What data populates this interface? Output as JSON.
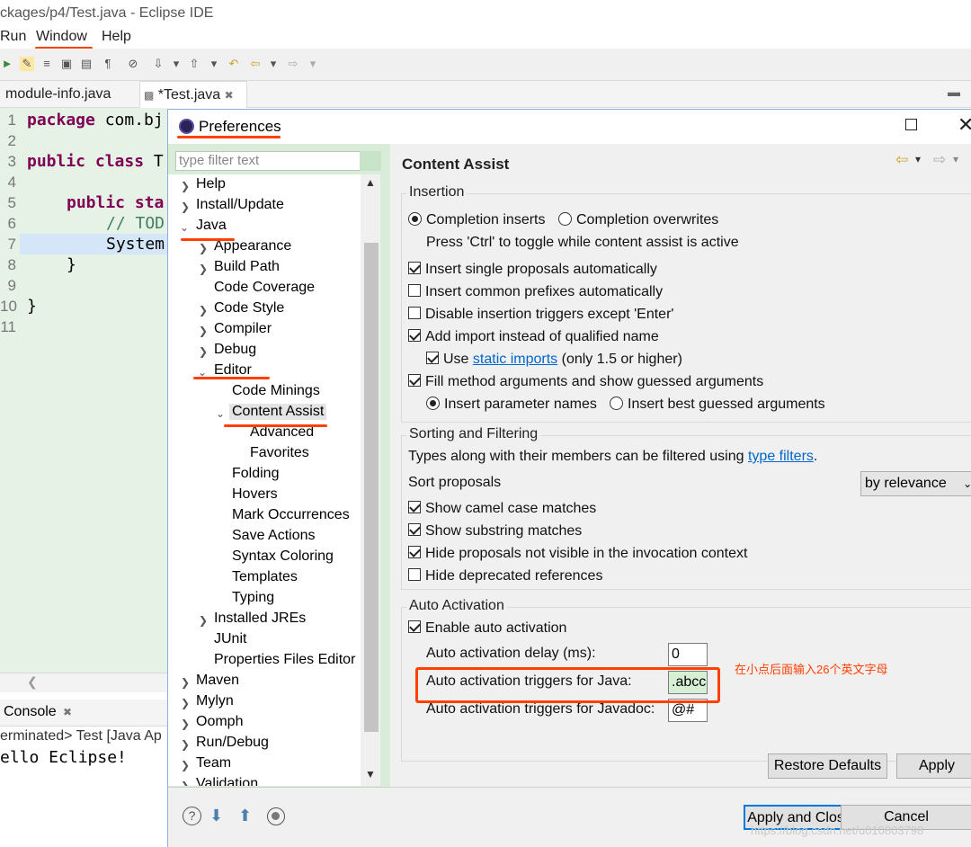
{
  "eclipse": {
    "title": "ckages/p4/Test.java - Eclipse IDE",
    "menu": [
      "Run",
      "Window",
      "Help"
    ],
    "tabs": [
      {
        "label": "module-info.java"
      },
      {
        "label": "*Test.java"
      }
    ],
    "line_numbers": [
      "1",
      "2",
      "3",
      "4",
      "5",
      "6",
      "7",
      "8",
      "9",
      "10",
      "11"
    ],
    "code": {
      "l1_kw": "package",
      "l1_rest": " com.bj",
      "l3_kw": "public class",
      "l3_rest": " T",
      "l5_kw": "public sta",
      "l6": "// TOD",
      "l7": "System",
      "l8": "}",
      "l10": "}"
    },
    "console_tab": "Console",
    "console_status": "erminated> Test [Java Ap",
    "console_output": "ello Eclipse!"
  },
  "dialog": {
    "title": "Preferences",
    "filter_placeholder": "type filter text",
    "tree": {
      "help": "Help",
      "install": "Install/Update",
      "java": "Java",
      "appearance": "Appearance",
      "build_path": "Build Path",
      "code_coverage": "Code Coverage",
      "code_style": "Code Style",
      "compiler": "Compiler",
      "debug": "Debug",
      "editor": "Editor",
      "code_minings": "Code Minings",
      "content_assist": "Content Assist",
      "advanced": "Advanced",
      "favorites": "Favorites",
      "folding": "Folding",
      "hovers": "Hovers",
      "mark_occurrences": "Mark Occurrences",
      "save_actions": "Save Actions",
      "syntax_coloring": "Syntax Coloring",
      "templates": "Templates",
      "typing": "Typing",
      "installed_jres": "Installed JREs",
      "junit": "JUnit",
      "props_editor": "Properties Files Editor",
      "maven": "Maven",
      "mylyn": "Mylyn",
      "oomph": "Oomph",
      "run_debug": "Run/Debug",
      "team": "Team",
      "validation": "Validation"
    },
    "page_title": "Content Assist",
    "insertion": {
      "label": "Insertion",
      "completion_inserts": "Completion inserts",
      "completion_overwrites": "Completion overwrites",
      "toggle_hint": "Press 'Ctrl' to toggle while content assist is active",
      "insert_single": "Insert single proposals automatically",
      "insert_common": "Insert common prefixes automatically",
      "disable_triggers": "Disable insertion triggers except 'Enter'",
      "add_import": "Add import instead of qualified name",
      "use_prefix": "Use",
      "static_imports": "static imports",
      "only15": "(only 1.5 or higher)",
      "fill_args": "Fill method arguments and show guessed arguments",
      "insert_param_names": "Insert parameter names",
      "insert_best_guess": "Insert best guessed arguments"
    },
    "sorting": {
      "label": "Sorting and Filtering",
      "types_text": "Types along with their members can be filtered using",
      "type_filters": "type filters",
      "period": ".",
      "sort_label": "Sort proposals",
      "sort_value": "by relevance",
      "camel": "Show camel case matches",
      "substring": "Show substring matches",
      "hide_not_visible": "Hide proposals not visible in the invocation context",
      "hide_deprecated": "Hide deprecated references"
    },
    "auto": {
      "label": "Auto Activation",
      "enable": "Enable auto activation",
      "delay_label": "Auto activation delay (ms):",
      "delay_value": "0",
      "java_label": "Auto activation triggers for Java:",
      "java_value": ".abcc",
      "javadoc_label": "Auto activation triggers for Javadoc:",
      "javadoc_value": "@#"
    },
    "annotation": "在小点后面输入26个英文字母",
    "buttons": {
      "restore": "Restore Defaults",
      "apply": "Apply",
      "apply_close": "Apply and Close",
      "cancel": "Cancel"
    },
    "watermark": "https://blog.csdn.net/u010803798"
  },
  "colors": {
    "annotation_red": "#ff4000",
    "link": "#0066cc",
    "tree_bg": "#d9ecd9"
  }
}
